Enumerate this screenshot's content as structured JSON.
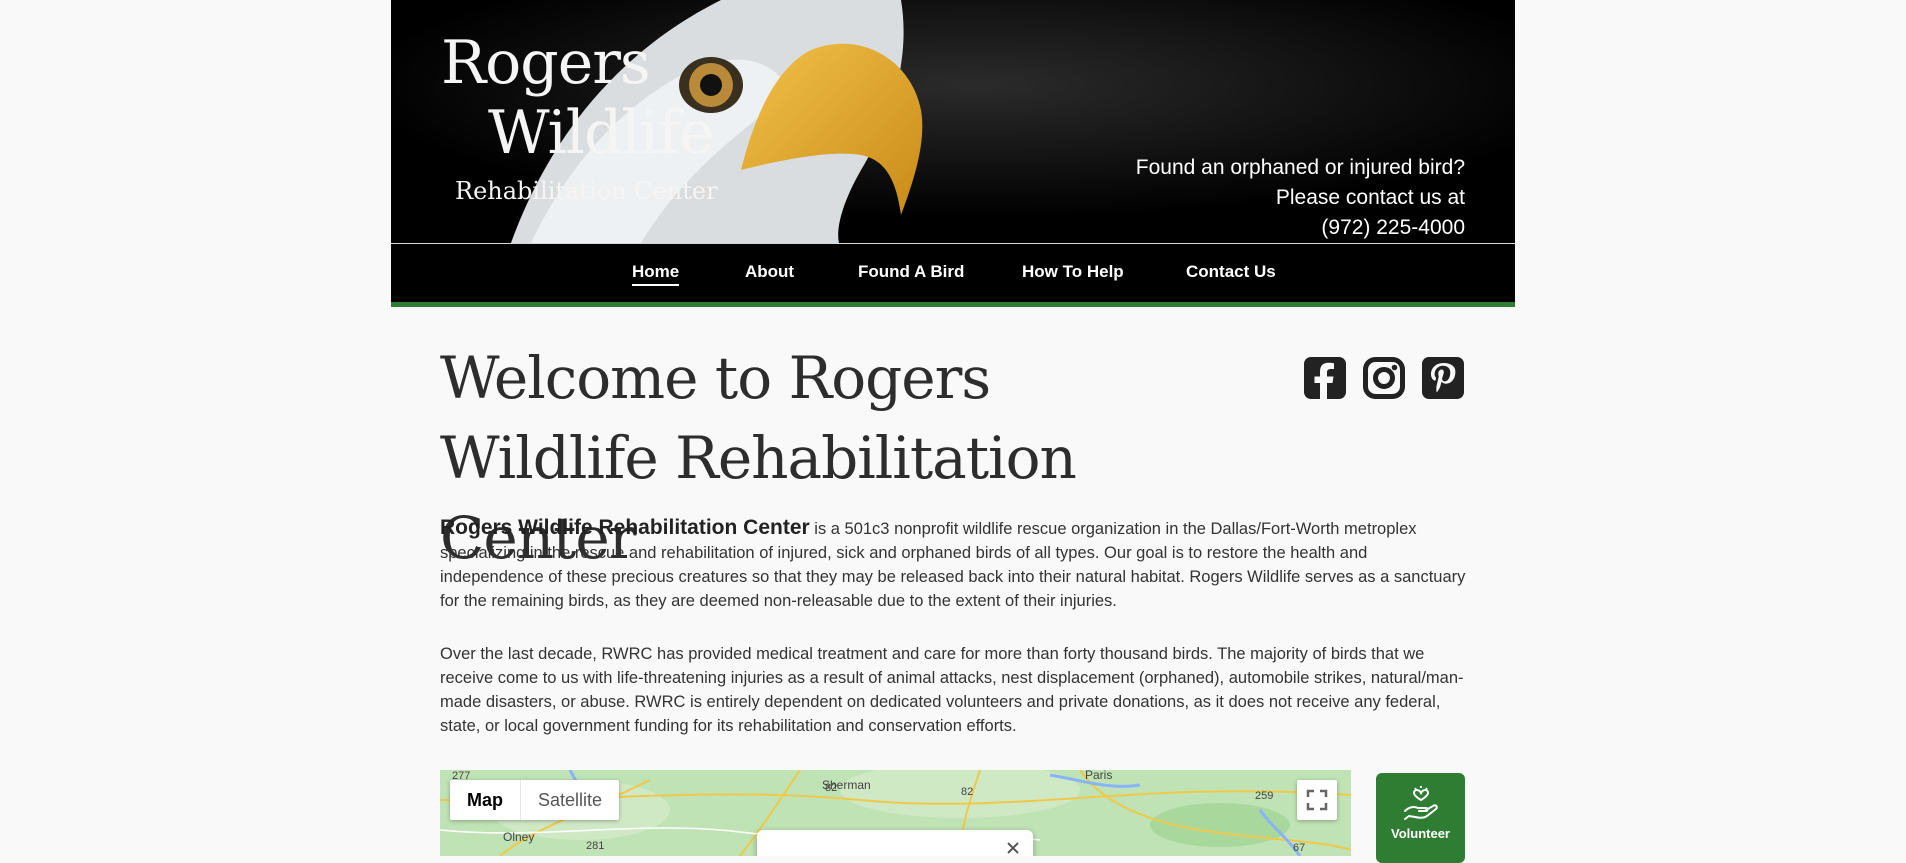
{
  "logo": {
    "line1": "Rogers",
    "line2": "Wildlife",
    "line3": "Rehabilitation Center"
  },
  "contact": {
    "line1": "Found an orphaned or injured bird?",
    "line2": "Please contact us at",
    "phone": "(972) 225-4000"
  },
  "nav": {
    "items": [
      {
        "label": "Home",
        "active": true
      },
      {
        "label": "About"
      },
      {
        "label": "Found A Bird"
      },
      {
        "label": "How To Help"
      },
      {
        "label": "Contact Us"
      }
    ]
  },
  "main": {
    "title": "Welcome to Rogers Wildlife Rehabilitation Center",
    "intro_bold": "Rogers Wildlife Rehabilitation Center",
    "intro_rest": " is a 501c3 nonprofit wildlife rescue organization in the Dallas/Fort-Worth metroplex specializing in the rescue and rehabilitation of injured, sick and orphaned birds of all types. Our goal is to restore the health and independence of these precious creatures so that they may be released back into their natural habitat. Rogers Wildlife serves as a sanctuary for the remaining birds, as they are deemed non-releasable due to the extent of their injuries.",
    "paragraph2": "Over the last decade, RWRC has provided medical treatment and care for more than forty thousand birds. The majority of birds that we receive come to us with life-threatening injuries as a result of animal attacks, nest displacement (orphaned), automobile strikes, natural/man-made disasters, or abuse. RWRC is entirely dependent on dedicated volunteers and private donations, as it does not receive any federal, state, or local government funding for its rehabilitation and conservation efforts."
  },
  "social": [
    "facebook-icon",
    "instagram-icon",
    "pinterest-icon"
  ],
  "map": {
    "map_label": "Map",
    "satellite_label": "Satellite",
    "places": [
      "Sherman",
      "Paris",
      "Olney"
    ],
    "road_shields": [
      "277",
      "82",
      "82",
      "259",
      "281",
      "67"
    ]
  },
  "volunteer": {
    "label": "Volunteer"
  },
  "colors": {
    "accent_green": "#2e7d32",
    "header_bg": "#000000",
    "page_bg": "#f9f9f9"
  }
}
